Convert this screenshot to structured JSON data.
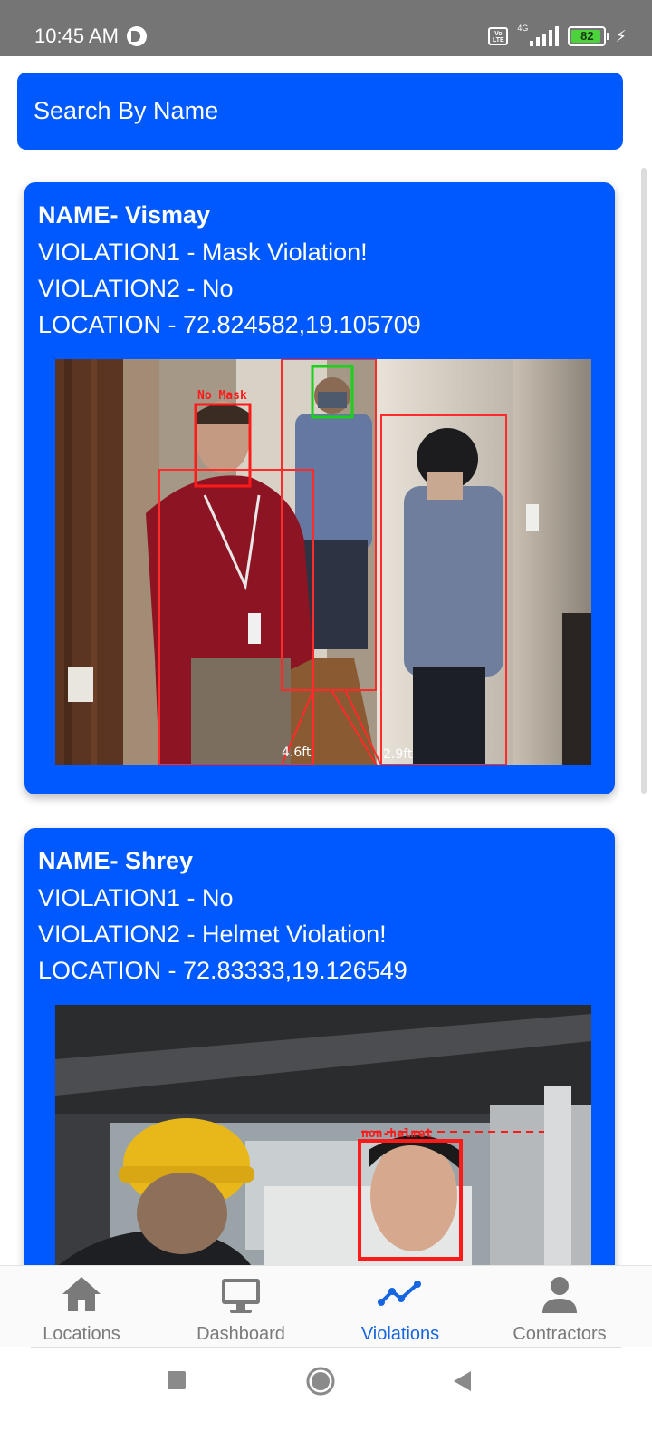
{
  "status_bar": {
    "time": "10:45 AM",
    "network": "4G",
    "volte": "Vo LTE",
    "battery_level": "82"
  },
  "search": {
    "placeholder": "Search By Name"
  },
  "violations": [
    {
      "name": "NAME- Vismay",
      "violation1": "VIOLATION1 - Mask Violation!",
      "violation2": "VIOLATION2 - No",
      "location": "LOCATION - 72.824582,19.105709",
      "photo_labels": {
        "tag": "No Mask",
        "dist1": "4.6ft",
        "dist2": "2.9ft"
      }
    },
    {
      "name": "NAME- Shrey",
      "violation1": "VIOLATION1 - No",
      "violation2": "VIOLATION2 - Helmet Violation!",
      "location": "LOCATION - 72.83333,19.126549",
      "photo_labels": {
        "tag": "non-helmet"
      }
    }
  ],
  "bottom_nav": {
    "items": [
      {
        "label": "Locations",
        "icon": "home-icon"
      },
      {
        "label": "Dashboard",
        "icon": "monitor-icon"
      },
      {
        "label": "Violations",
        "icon": "trend-line-icon"
      },
      {
        "label": "Contractors",
        "icon": "person-icon"
      }
    ],
    "active_index": 2,
    "active_color": "#1566e0",
    "inactive_color": "#7a7a7a"
  },
  "colors": {
    "accent": "#0059ff",
    "status_bar": "#757575"
  }
}
